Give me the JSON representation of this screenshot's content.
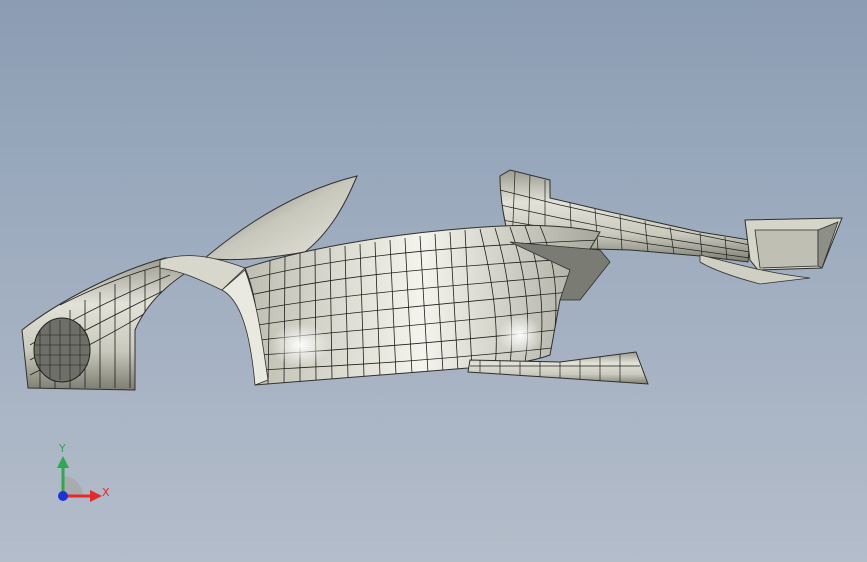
{
  "viewport": {
    "background_top": "#8b9db3",
    "background_bottom": "#b4bdca",
    "model": "car-body-surface-wireframe"
  },
  "triad": {
    "y_label": "Y",
    "x_label": "X",
    "y_color": "#2fa84f",
    "x_color": "#e32b2b",
    "z_color": "#1d35d8"
  }
}
